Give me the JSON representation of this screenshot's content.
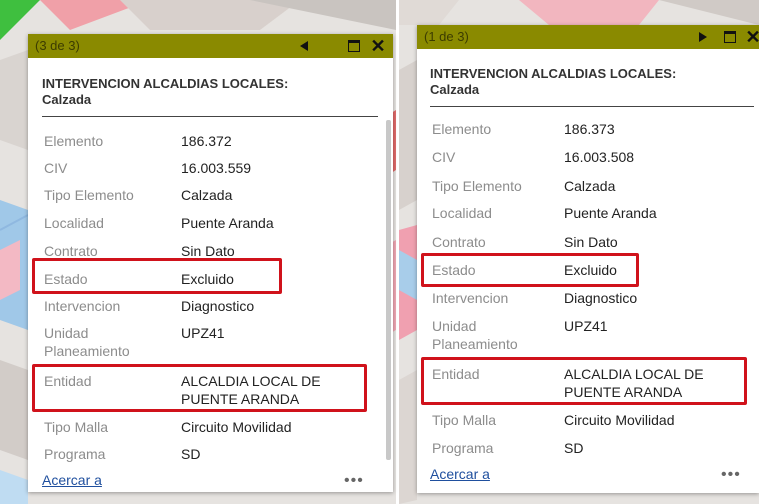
{
  "left": {
    "counter": "(3 de 3)",
    "title_line1": "INTERVENCION ALCALDIAS LOCALES:",
    "title_line2": "Calzada",
    "fields": [
      {
        "label": "Elemento",
        "value": "186.372"
      },
      {
        "label": "CIV",
        "value": "16.003.559"
      },
      {
        "label": "Tipo Elemento",
        "value": "Calzada"
      },
      {
        "label": "Localidad",
        "value": "Puente Aranda"
      },
      {
        "label": "Contrato",
        "value": "Sin Dato"
      },
      {
        "label": "Estado",
        "value": "Excluido"
      },
      {
        "label": "Intervencion",
        "value": "Diagnostico"
      },
      {
        "label": "Unidad",
        "label2": "Planeamiento",
        "value": "UPZ41"
      },
      {
        "label": "Entidad",
        "value": "ALCALDIA LOCAL DE",
        "value2": "PUENTE ARANDA"
      },
      {
        "label": "Tipo Malla",
        "value": "Circuito Movilidad"
      },
      {
        "label": "Programa",
        "value": "SD"
      }
    ],
    "zoom_link": "Acercar a",
    "more": "•••"
  },
  "right": {
    "counter": "(1 de 3)",
    "title_line1": "INTERVENCION ALCALDIAS LOCALES:",
    "title_line2": "Calzada",
    "fields": [
      {
        "label": "Elemento",
        "value": "186.373"
      },
      {
        "label": "CIV",
        "value": "16.003.508"
      },
      {
        "label": "Tipo Elemento",
        "value": "Calzada"
      },
      {
        "label": "Localidad",
        "value": "Puente Aranda"
      },
      {
        "label": "Contrato",
        "value": "Sin Dato"
      },
      {
        "label": "Estado",
        "value": "Excluido"
      },
      {
        "label": "Intervencion",
        "value": "Diagnostico"
      },
      {
        "label": "Unidad",
        "label2": "Planeamiento",
        "value": "UPZ41"
      },
      {
        "label": "Entidad",
        "value": "ALCALDIA LOCAL DE",
        "value2": "PUENTE ARANDA"
      },
      {
        "label": "Tipo Malla",
        "value": "Circuito Movilidad"
      },
      {
        "label": "Programa",
        "value": "SD"
      }
    ],
    "zoom_link": "Acercar a",
    "more": "•••"
  },
  "colors": {
    "titlebar": "#8a8a00",
    "highlight": "#d0121b",
    "link": "#1f4f9e"
  }
}
